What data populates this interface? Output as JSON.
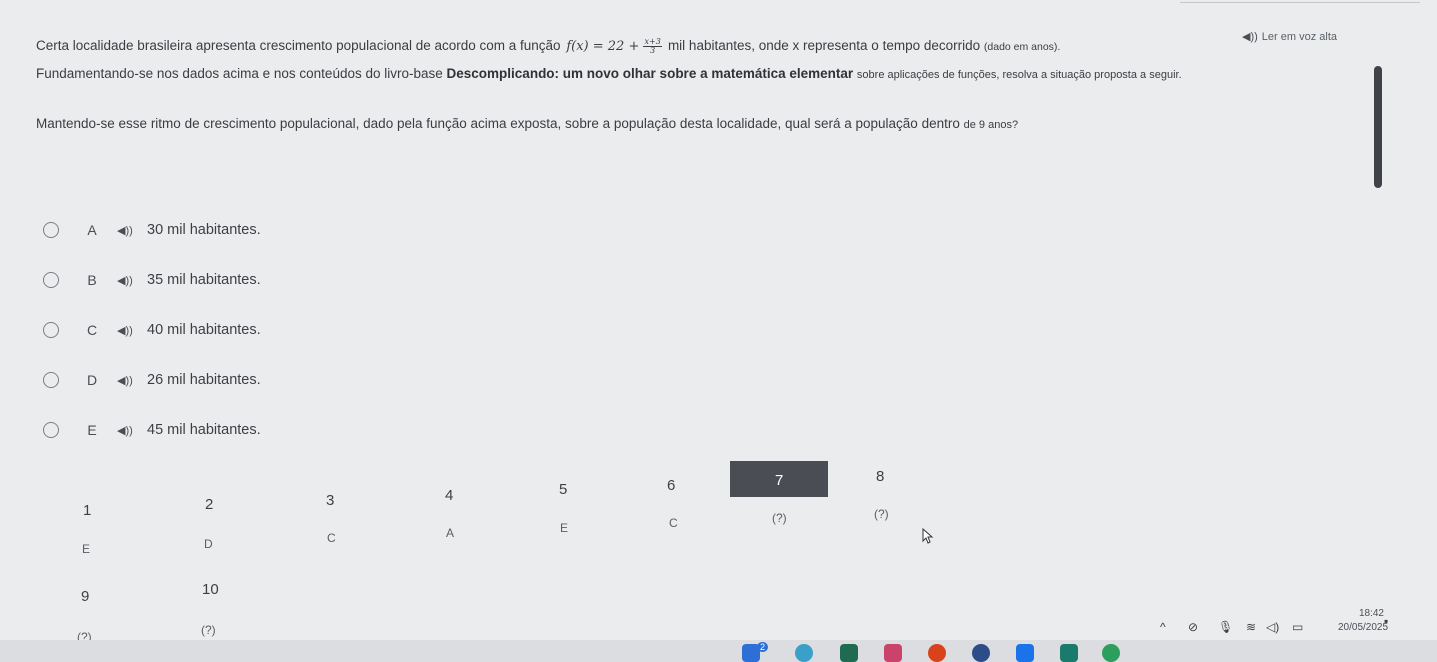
{
  "tts": {
    "label": "Ler em voz alta",
    "icon": "speaker-icon"
  },
  "question": {
    "intro": "Certa localidade brasileira apresenta crescimento populacional de acordo com a função",
    "formula_prefix": "f(x) = 22 +",
    "formula_num": "x+3",
    "formula_den": "3",
    "after_formula": "mil habitantes, onde x representa o tempo decorrido",
    "after_formula_small": "(dado em anos).",
    "p2_start": "Fundamentando-se nos dados acima e nos conteúdos do livro-base",
    "p2_bold": "Descomplicando: um novo olhar sobre a matemática elementar",
    "p2_end": "sobre aplicações de funções, resolva a situação proposta a seguir.",
    "p3_main": "Mantendo-se esse ritmo de crescimento populacional, dado pela função acima exposta, sobre a população desta localidade, qual será a população dentro",
    "p3_small": "de 9 anos?"
  },
  "options": [
    {
      "letter": "A",
      "text": "30 mil habitantes."
    },
    {
      "letter": "B",
      "text": "35 mil habitantes."
    },
    {
      "letter": "C",
      "text": "40 mil habitantes."
    },
    {
      "letter": "D",
      "text": "26 mil habitantes."
    },
    {
      "letter": "E",
      "text": "45 mil habitantes."
    }
  ],
  "navigator": [
    {
      "num": "1",
      "answer": "E"
    },
    {
      "num": "2",
      "answer": "D"
    },
    {
      "num": "3",
      "answer": "C"
    },
    {
      "num": "4",
      "answer": "A"
    },
    {
      "num": "5",
      "answer": "E"
    },
    {
      "num": "6",
      "answer": "C"
    },
    {
      "num": "7",
      "answer": "(?)",
      "active": true
    },
    {
      "num": "8",
      "answer": "(?)"
    },
    {
      "num": "9",
      "answer": "(?)"
    },
    {
      "num": "10",
      "answer": "(?)"
    }
  ],
  "taskbar": {
    "time": "18:42",
    "date": "20/05/2025",
    "badge": "2"
  },
  "colors": {
    "background": "#ebecee",
    "active_question": "#4a4e54",
    "text": "#3a3d42"
  }
}
